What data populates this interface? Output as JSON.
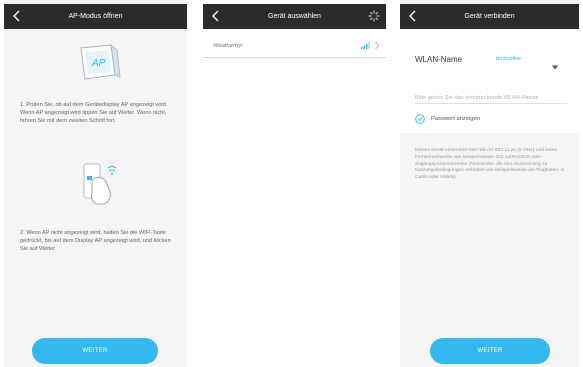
{
  "screen1": {
    "title": "AP-Modus öffnen",
    "ap_label": "AP",
    "step1": "1. Prüfen Sie, ob auf dem Gerätedisplay AP angezeigt wird. Wenn AP angezeigt wird tippen Sie auf Weiter. Wenn nicht, fahren Sie mit dem zweiten Schritt fort.",
    "step2": "2. Wenn AP nicht angezeigt wird, halten Sie die WIFI-Taste gedrückt, bis auf dem Display AP angezeigt wird, und klicken Sie auf Weiter.",
    "button_label": "WEITER"
  },
  "screen2": {
    "title": "Gerät auswählen",
    "devices": [
      {
        "label": "Weathertyp"
      }
    ]
  },
  "screen3": {
    "title": "Gerät verbinden",
    "wlan_label": "WLAN-Name",
    "wlan_value": "technoline",
    "password_placeholder": "Bitte geben Sie das entsprechende WLAN-Passw",
    "show_password_label": "Passwort anzeigen",
    "notice": "Dieses Gerät unterstützt kein WLAN 802.11 ac (5 GHz) und keine Firmennetzwerke wie beispielsweise 802.1x/RADIUS oder Zugangsportanetzwerke (Netzwerke, die Ihre Zustimmung zu Nutzungsbedingungen erfordern wie beispielsweise am Flughafen, in Cafés oder Hotels).",
    "button_label": "WEITER"
  },
  "colors": {
    "topbar": "#2b2b2b",
    "accent": "#35b8f0",
    "background": "#f5f5f5"
  }
}
